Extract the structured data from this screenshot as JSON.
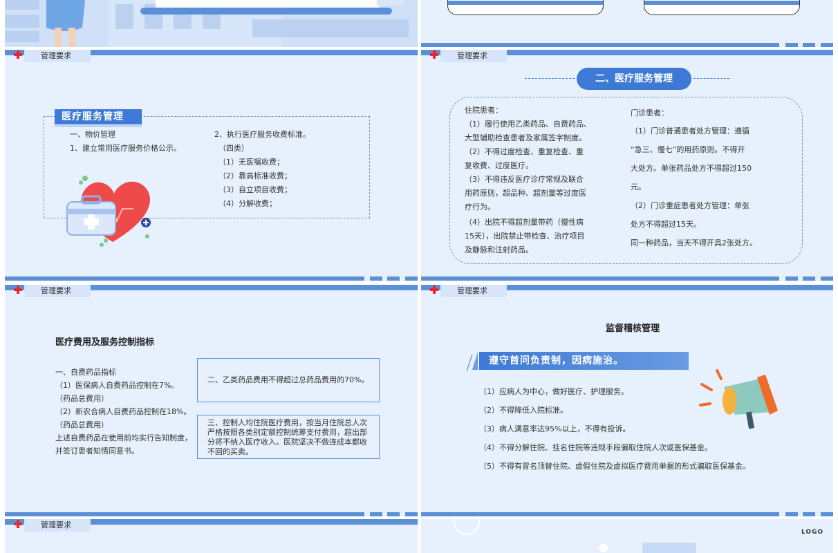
{
  "section_tag": "管理要求",
  "slide1": {
    "title": "医疗服务管理",
    "left_lines": [
      "一、物价管理",
      "1、建立常用医疗服务价格公示。"
    ],
    "right_lines": [
      "2、执行医疗服务收费标准。",
      "（四类）",
      "（1）无医嘱收费；",
      "（2）靠高标准收费；",
      "（3）自立项目收费；",
      "（4）分解收费；"
    ]
  },
  "slide2": {
    "title": "二、医疗服务管理",
    "left_lines": [
      "住院患者：",
      "（1）履行使用乙类药品、自费药品、",
      "大型辅助检查患者及家属签字制度。",
      "（2）不得过度检查、重复检查、重",
      "复收费、过度医疗。",
      "（3）不得违反医疗诊疗常规及联合",
      "用药原则，超品种、超剂量等过度医",
      "疗行为。",
      "（4）出院不得超剂量带药（慢性病",
      "15天），出院禁止带检查、治疗项目",
      "及静脉和注射药品。"
    ],
    "right_lines": [
      "门诊患者：",
      "（1）门诊普通患者处方管理：遵循",
      "“急三、慢七”的用药原则。不得开",
      "大处方。单张药品处方不得超过150",
      "元。",
      "（2）门诊重症患者处方管理：单张",
      "处方不得超过15天。",
      "同一种药品，当天不得开具2张处方。"
    ]
  },
  "slide3": {
    "title": "医疗费用及服务控制指标",
    "left_lines": [
      "一、自费药品指标",
      "（1）医保病人自费药品控制在7%。",
      "（药品总费用）",
      "（2）新农合病人自费药品控制在18%。",
      "（药品总费用）",
      "上述自费药品在使用前均实行告知制度，",
      "并签订患者知情同意书。"
    ],
    "box1": "二、乙类药品费用不得超过总药品费用的70%。",
    "box2_lines": [
      "三、控制人均住院医疗费用，按当月住院总人次",
      "严格按照各类别定额控制统筹支付费用，超出部",
      "分将不纳入医疗收入。医院坚决不做连成本都收",
      "不回的买卖。"
    ]
  },
  "slide4": {
    "title": "监督稽核管理",
    "band": "遵守首问负责制，因病施治。",
    "lines": [
      "（1）应病人为中心，做好医疗、护理服务。",
      "（2）不得降低入院标准。",
      "（3）病人满意率达95%以上，不得有投诉。",
      "（4）不得分解住院、挂名住院等违规手段骗取住院人次或医保基金。",
      "（5）不得有冒名顶替住院、虚假住院及虚拟医疗费用单据的形式骗取医保基金。"
    ]
  },
  "slide6": {
    "logo": "LOGO"
  },
  "colors": {
    "accent": "#3e79d6",
    "bar": "#5b8fd8",
    "background": "#e7f1fd",
    "cross": "#e8262f"
  }
}
